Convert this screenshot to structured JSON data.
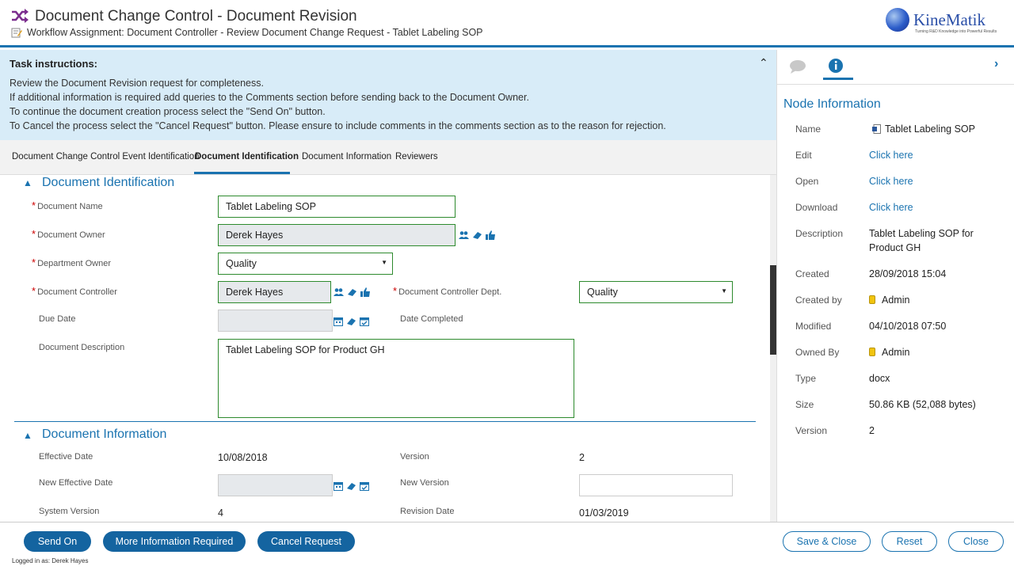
{
  "header": {
    "title": "Document Change Control - Document Revision",
    "subtitle": "Workflow Assignment: Document Controller - Review Document Change Request - Tablet Labeling SOP",
    "logo_name": "KineMatik",
    "logo_tagline": "Turning R&D Knowledge into Powerful Results",
    "icon_app": "shuffle-icon",
    "icon_sub": "edit-document-icon"
  },
  "instructions": {
    "heading": "Task instructions:",
    "lines": [
      "Review the Document Revision request for completeness.",
      "If additional information is required add queries to the Comments section before sending back to the Document Owner.",
      "To continue the document creation process select the \"Send On\" button.",
      "To Cancel the process select the \"Cancel Request\" button. Please ensure to include comments in the comments section as to the reason for rejection."
    ]
  },
  "tabs": [
    {
      "label": "Document Change Control Event Identification",
      "active": false
    },
    {
      "label": "Document Identification",
      "active": true
    },
    {
      "label": "Document Information",
      "active": false
    },
    {
      "label": "Reviewers",
      "active": false
    }
  ],
  "doc_identification": {
    "heading": "Document Identification",
    "document_name": {
      "label": "Document Name",
      "value": "Tablet Labeling SOP"
    },
    "document_owner": {
      "label": "Document Owner",
      "value": "Derek Hayes"
    },
    "department_owner": {
      "label": "Department Owner",
      "value": "Quality"
    },
    "document_controller": {
      "label": "Document Controller",
      "value": "Derek Hayes"
    },
    "controller_dept": {
      "label": "Document Controller Dept.",
      "value": "Quality"
    },
    "due_date": {
      "label": "Due Date",
      "value": ""
    },
    "date_completed": {
      "label": "Date Completed",
      "value": ""
    },
    "description": {
      "label": "Document Description",
      "value": "Tablet Labeling SOP for Product GH"
    }
  },
  "doc_information": {
    "heading": "Document Information",
    "effective_date": {
      "label": "Effective Date",
      "value": "10/08/2018"
    },
    "version": {
      "label": "Version",
      "value": "2"
    },
    "new_effective_date": {
      "label": "New Effective Date",
      "value": ""
    },
    "new_version": {
      "label": "New Version",
      "value": ""
    },
    "system_version": {
      "label": "System Version",
      "value": "4"
    },
    "revision_date": {
      "label": "Revision Date",
      "value": "01/03/2019"
    }
  },
  "side": {
    "title": "Node Information",
    "rows": [
      {
        "key": "Name",
        "value": "Tablet Labeling SOP"
      },
      {
        "key": "Edit",
        "value": "Click here"
      },
      {
        "key": "Open",
        "value": "Click here"
      },
      {
        "key": "Download",
        "value": "Click here"
      },
      {
        "key": "Description",
        "value": "Tablet Labeling SOP for",
        "value2": "Product GH"
      },
      {
        "key": "Created",
        "value": "28/09/2018 15:04"
      },
      {
        "key": "Created by",
        "value": "Admin"
      },
      {
        "key": "Modified",
        "value": "04/10/2018 07:50"
      },
      {
        "key": "Owned By",
        "value": "Admin"
      },
      {
        "key": "Type",
        "value": "docx"
      },
      {
        "key": "Size",
        "value": "50.86 KB (52,088 bytes)"
      },
      {
        "key": "Version",
        "value": "2"
      }
    ]
  },
  "footer": {
    "send_on": "Send On",
    "more_info": "More Information Required",
    "cancel_request": "Cancel Request",
    "save_close": "Save & Close",
    "reset": "Reset",
    "close": "Close",
    "logged_in": "Logged in as: Derek Hayes"
  },
  "colors": {
    "accent": "#1a73b0",
    "primary_button": "#1464a0",
    "instructions_bg": "#d8ecf8",
    "field_border": "#2d8a2d",
    "required": "#cc0000"
  }
}
